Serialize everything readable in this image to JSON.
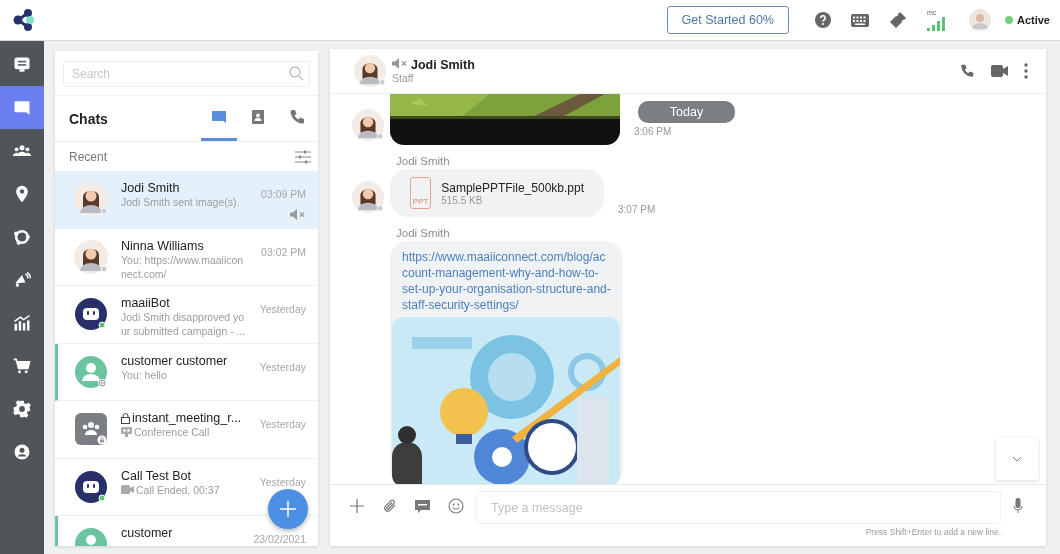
{
  "topbar": {
    "get_started": "Get Started 60%",
    "signal_label": "mc",
    "status": "Active",
    "online": true
  },
  "sidebar": {
    "items": [
      {
        "selected": false
      },
      {
        "selected": true
      },
      {
        "selected": false
      },
      {
        "selected": false
      },
      {
        "selected": false
      },
      {
        "selected": false
      },
      {
        "selected": false
      },
      {
        "selected": false
      },
      {
        "selected": false
      },
      {
        "selected": false
      }
    ]
  },
  "chat_list": {
    "search": {
      "placeholder": "Search"
    },
    "title": "Chats",
    "tabs": [
      {
        "selected": true
      },
      {
        "selected": false
      },
      {
        "selected": false
      }
    ],
    "section": "Recent",
    "chats": [
      {
        "name": "Jodi Smith",
        "preview": {
          "kind": "text",
          "text": "Jodi Smith sent image(s)."
        },
        "time": "03:09 PM",
        "kind": "person",
        "selected": true,
        "muted": true,
        "highlighted": false,
        "locked": false
      },
      {
        "name": "Ninna Williams",
        "preview": {
          "kind": "text",
          "text": "You: https://www.maaiiconnect.com/"
        },
        "time": "03:02 PM",
        "kind": "person",
        "selected": false,
        "muted": false,
        "highlighted": false,
        "locked": false
      },
      {
        "name": "maaiiBot",
        "preview": {
          "kind": "text",
          "text": "Jodi Smith disapproved your submitted campaign - ..."
        },
        "time": "Yesterday",
        "kind": "bot",
        "selected": false,
        "muted": false,
        "highlighted": false,
        "locked": false
      },
      {
        "name": "customer customer",
        "preview": {
          "kind": "text",
          "text": "You: hello"
        },
        "time": "Yesterday",
        "kind": "customer",
        "selected": false,
        "muted": false,
        "highlighted": true,
        "locked": false
      },
      {
        "name": "instant_meeting_r...",
        "preview": {
          "kind": "conference",
          "text": "Conference Call"
        },
        "time": "Yesterday",
        "kind": "group",
        "selected": false,
        "muted": false,
        "highlighted": false,
        "locked": true
      },
      {
        "name": "Call Test Bot",
        "preview": {
          "kind": "video",
          "text": "Call Ended, 00:37"
        },
        "time": "Yesterday",
        "kind": "bot",
        "selected": false,
        "muted": false,
        "highlighted": false,
        "locked": false
      },
      {
        "name": "customer",
        "time": "23/02/2021",
        "kind": "customer",
        "selected": false,
        "muted": false,
        "highlighted": true,
        "locked": false
      }
    ]
  },
  "conversation": {
    "name": "Jodi Smith",
    "role": "Staff",
    "muted": true,
    "date_label": "Today",
    "messages": [
      {
        "show_avatar": true,
        "time": "3:06 PM"
      },
      {
        "kind": "file",
        "show_avatar": true,
        "sender": "Jodi Smith",
        "file_name": "SamplePPTFile_500kb.ppt",
        "file_type": "PPT",
        "size": "515.5 KB",
        "time": "3:07 PM"
      },
      {
        "kind": "link",
        "show_avatar": false,
        "sender": "Jodi Smith",
        "url": "https://www.maaiiconnect.com/blog/account-management-why-and-how-to-set-up-your-organisation-structure-and-staff-security-settings/"
      }
    ],
    "composer": {
      "placeholder": "Type a message",
      "hint": "Press Shift+Enter to add a new line."
    }
  }
}
